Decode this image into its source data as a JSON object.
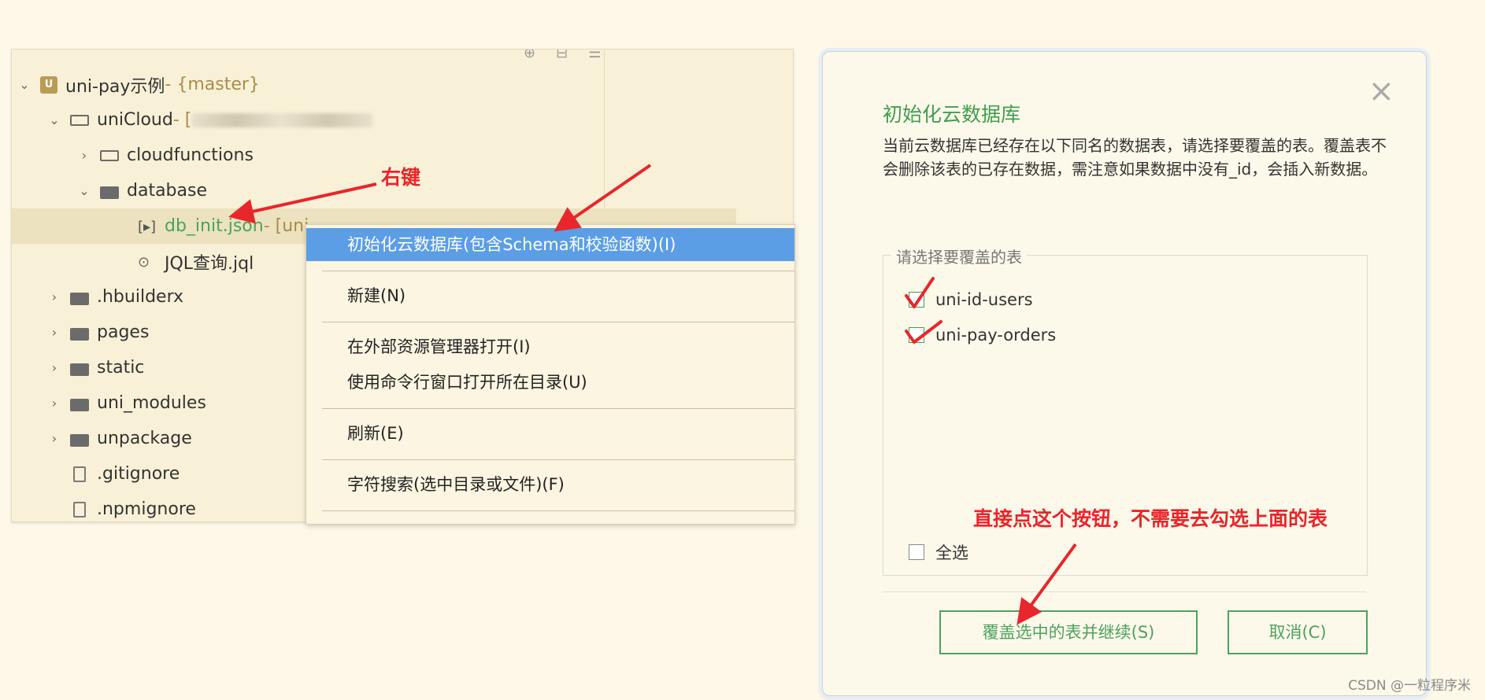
{
  "tree": {
    "items": [
      {
        "label": "uni-pay示例",
        "suffix": " - {master}"
      },
      {
        "label": "uniCloud",
        "suffix": " - ["
      },
      {
        "label": "cloudfunctions"
      },
      {
        "label": "database"
      },
      {
        "label": "db_init.json",
        "suffix": " - [uni"
      },
      {
        "label": "JQL查询.jql"
      },
      {
        "label": ".hbuilderx"
      },
      {
        "label": "pages"
      },
      {
        "label": "static"
      },
      {
        "label": "uni_modules"
      },
      {
        "label": "unpackage"
      },
      {
        "label": ".gitignore"
      },
      {
        "label": ".npmignore"
      }
    ]
  },
  "context_menu": {
    "items": [
      "初始化云数据库(包含Schema和校验函数)(I)",
      "新建(N)",
      "在外部资源管理器打开(I)",
      "使用命令行窗口打开所在目录(U)",
      "刷新(E)",
      "字符搜索(选中目录或文件)(F)"
    ]
  },
  "dialog": {
    "close": "×",
    "title": "初始化云数据库",
    "desc": "当前云数据库已经存在以下同名的数据表，请选择要覆盖的表。覆盖表不会删除该表的已存在数据，需注意如果数据中没有_id，会插入新数据。",
    "legend": "请选择要覆盖的表",
    "tables": [
      {
        "name": "uni-id-users",
        "checked": true
      },
      {
        "name": "uni-pay-orders",
        "checked": true
      }
    ],
    "select_all": "全选",
    "confirm": "覆盖选中的表并继续(S)",
    "cancel": "取消(C)"
  },
  "annotations": {
    "right_click": "右键",
    "hint": "直接点这个按钮，不需要去勾选上面的表"
  },
  "watermark": "CSDN @一粒程序米",
  "colors": {
    "annotation": "#e8262b",
    "accent_green": "#4ca25c",
    "menu_highlight": "#5b9ee6"
  }
}
